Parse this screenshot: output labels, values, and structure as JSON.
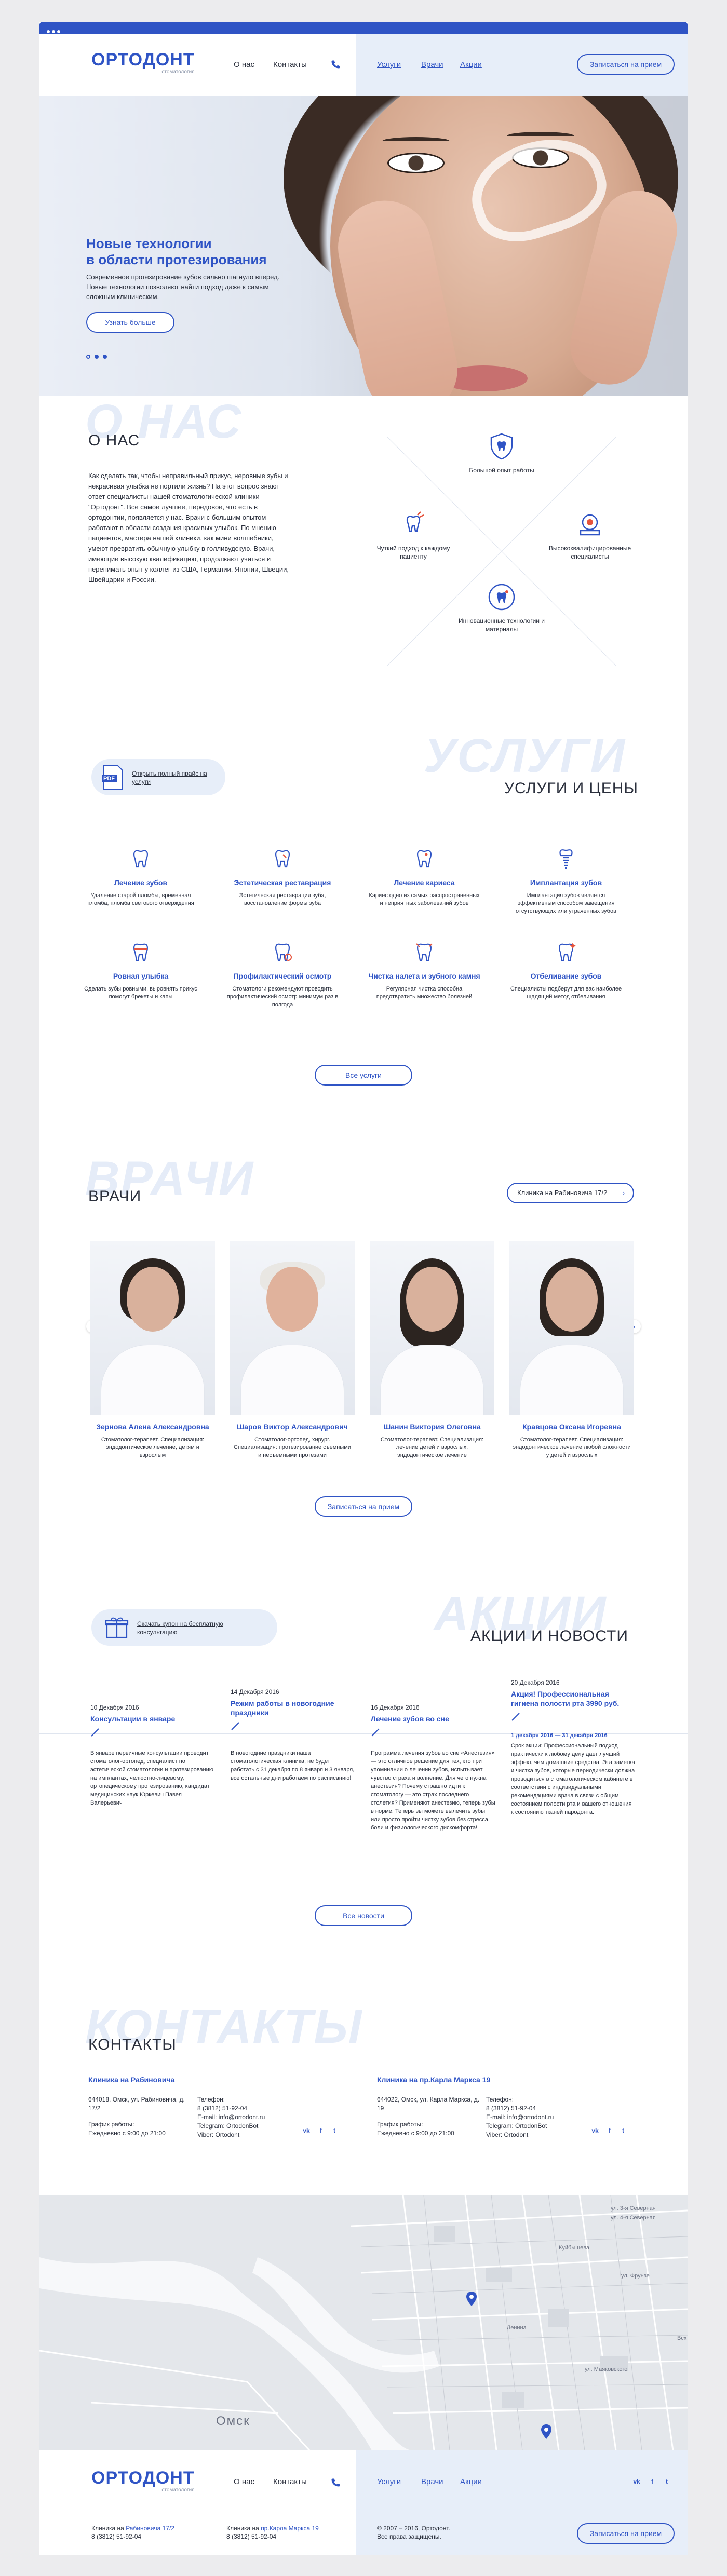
{
  "header": {
    "logo_name": "ОРТОДОНТ",
    "logo_sub": "стоматология",
    "nav_left": [
      "О нас",
      "Контакты"
    ],
    "nav_right": [
      "Услуги",
      "Врачи",
      "Акции"
    ],
    "cta": "Записаться на прием"
  },
  "hero": {
    "title_line1": "Новые технологии",
    "title_line2": "в области протезирования",
    "text": "Современное протезирование зубов сильно шагнуло вперед. Новые технологии позволяют найти подход даже к самым сложным клиническим.",
    "button": "Узнать больше"
  },
  "about": {
    "bg_word": "О НАС",
    "title": "О НАС",
    "text": "Как сделать так, чтобы неправильный прикус, неровные зубы и некрасивая улыбка не портили жизнь? На этот вопрос знают ответ специалисты нашей стоматологической клиники \"Ортодонт\". Все самое лучшее, передовое, что есть в ортодонтии, появляется у нас. Врачи с большим опытом работают в области создания красивых улыбок. По мнению пациентов, мастера нашей клиники, как мини волшебники, умеют превратить обычную улыбку в голливудскую. Врачи, имеющие высокую квалификацию, продолжают учиться и перенимать опыт у коллег из США, Германии, Японии, Швеции, Швейцарии и России.",
    "advantages": [
      {
        "icon": "tooth-shield-icon",
        "text": "Большой опыт работы"
      },
      {
        "icon": "tooth-care-icon",
        "text": "Чуткий подход к каждому пациенту"
      },
      {
        "icon": "specialist-badge-icon",
        "text": "Высококвалифицированные специалисты"
      },
      {
        "icon": "tooth-innovation-icon",
        "text": "Инновационные технологии и материалы"
      }
    ]
  },
  "services": {
    "bg_word": "УСЛУГИ",
    "title": "УСЛУГИ И ЦЕНЫ",
    "pdf_link": "Открыть полный прайс на услуги",
    "items": [
      {
        "title": "Лечение зубов",
        "desc": "Удаление старой пломбы, временная пломба, пломба светового отверждения"
      },
      {
        "title": "Эстетическая реставрация",
        "desc": "Эстетическая реставрация зуба, восстановление формы зуба"
      },
      {
        "title": "Лечение кариеса",
        "desc": "Кариес одно из самых распространенных и неприятных заболеваний зубов"
      },
      {
        "title": "Имплантация зубов",
        "desc": "Имплантация зубов является эффективным способом замещения отсутствующих или утраченных зубов"
      },
      {
        "title": "Ровная улыбка",
        "desc": "Сделать зубы ровными, выровнять прикус помогут брекеты и капы"
      },
      {
        "title": "Профилактический осмотр",
        "desc": "Стоматологи рекомендуют проводить профилактический осмотр минимум раз в полгода"
      },
      {
        "title": "Чистка налета и зубного камня",
        "desc": "Регулярная чистка способна предотвратить множество болезней"
      },
      {
        "title": "Отбеливание зубов",
        "desc": "Специалисты подберут для вас наиболее щадящий метод отбеливания"
      }
    ],
    "button": "Все услуги"
  },
  "doctors": {
    "bg_word": "ВРАЧИ",
    "title": "ВРАЧИ",
    "clinic_select": "Клиника на Рабиновича 17/2",
    "items": [
      {
        "name": "Зернова Алена Александровна",
        "desc": "Стоматолог-терапевт. Специализация: эндодонтическое лечение, детям и взрослым"
      },
      {
        "name": "Шаров Виктор Александрович",
        "desc": "Стоматолог-ортопед, хирург. Специализация: протезирование съемными и несъемными протезами"
      },
      {
        "name": "Шанин Виктория Олеговна",
        "desc": "Стоматолог-терапевт. Специализация: лечение детей и взрослых, эндодонтическое лечение"
      },
      {
        "name": "Кравцова Оксана Игоревна",
        "desc": "Стоматолог-терапевт. Специализация: эндодонтическое лечение любой сложности у детей и взрослых"
      }
    ],
    "button": "Записаться на прием"
  },
  "promos": {
    "bg_word": "АКЦИИ",
    "title": "АКЦИИ И НОВОСТИ",
    "coupon_link": "Скачать купон на бесплатную консультацию",
    "items": [
      {
        "date": "10 Декабря 2016",
        "title": "Консультации в январе",
        "body": "В январе первичные консультации проводит стоматолог-ортопед, специалист по эстетической стоматологии и протезированию на имплантах, челюстно-лицевому, ортопедическому протезированию, кандидат медицинских наук Юркевич Павел Валерьевич"
      },
      {
        "date": "14 Декабря 2016",
        "title": "Режим работы в новогодние праздники",
        "body": "В новогодние праздники наша стоматологическая клиника, не будет работать с 31 декабря по 8 января и 3 января, все остальные дни работаем по расписанию!"
      },
      {
        "date": "16 Декабря 2016",
        "title": "Лечение зубов во сне",
        "body": "Программа лечения зубов во сне «Анестезия» — это отличное решение для тех, кто при упоминании о лечении зубов, испытывает чувство страха и волнение. Для чего нужна анестезия? Почему страшно идти к стоматологу — это страх последнего столетия? Применяют анестезию, теперь зубы в норме. Теперь вы можете вылечить зубы или просто пройти чистку зубов без стресса, боли и физиологического дискомфорта!"
      },
      {
        "date": "20 Декабря 2016",
        "title": "Акция! Профессиональная гигиена полости рта 3990 руб.",
        "period": "1 декабря 2016 — 31 декабря 2016",
        "body": "Срок акции: Профессиональный подход практически к любому делу дает лучший эффект, чем домашние средства. Эта заметка и чистка зубов, которые периодически должна проводиться в стоматологическом кабинете в соответствии с индивидуальными рекомендациями врача в связи с общим состоянием полости рта и вашего отношения к состоянию тканей пародонта."
      }
    ],
    "button": "Все новости"
  },
  "contacts": {
    "bg_word": "КОНТАКТЫ",
    "title": "КОНТАКТЫ",
    "clinics": [
      {
        "name": "Клиника на Рабиновича",
        "address": "644018, Омск, ул. Рабиновича, д. 17/2",
        "schedule_label": "График работы:",
        "schedule": "Ежедневно с 9:00 до 21:00",
        "phone_label": "Телефон:",
        "phone": "8 (3812) 51-92-04",
        "email": "E-mail: info@ortodont.ru",
        "telegram": "Telegram: OrtodonBot",
        "viber": "Viber: Ortodont"
      },
      {
        "name": "Клиника на пр.Карла Маркса 19",
        "address": "644022, Омск, ул. Карла Маркса, д. 19",
        "schedule_label": "График работы:",
        "schedule": "Ежедневно с 9:00 до 21:00",
        "phone_label": "Телефон:",
        "phone": "8 (3812) 51-92-04",
        "email": "E-mail: info@ortodont.ru",
        "telegram": "Telegram: OrtodonBot",
        "viber": "Viber: Ortodont"
      }
    ]
  },
  "map": {
    "city": "Омск",
    "labels": [
      "ул. 3-я Северная",
      "ул. 4-я Северная",
      "Куйбышева",
      "ул. Фрунзе",
      "Ленина",
      "ул. Маяковского",
      "Всх"
    ]
  },
  "footer": {
    "logo_name": "ОРТОДОНТ",
    "logo_sub": "стоматология",
    "nav_left": [
      "О нас",
      "Контакты"
    ],
    "nav_right": [
      "Услуги",
      "Врачи",
      "Акции"
    ],
    "clinic1_label": "Клиника на ",
    "clinic1_link": "Рабиновича 17/2",
    "clinic1_phone": "8 (3812) 51-92-04",
    "clinic2_label": "Клиника на ",
    "clinic2_link": "пр.Карла Маркса 19",
    "clinic2_phone": "8 (3812) 51-92-04",
    "copyright": "© 2007 – 2016, Ортодонт.",
    "rights": "Все права защищены.",
    "cta": "Записаться на прием"
  },
  "colors": {
    "accent": "#2f54c5",
    "light_panel": "#e7eef9",
    "bg_word": "#e5ecf8"
  }
}
